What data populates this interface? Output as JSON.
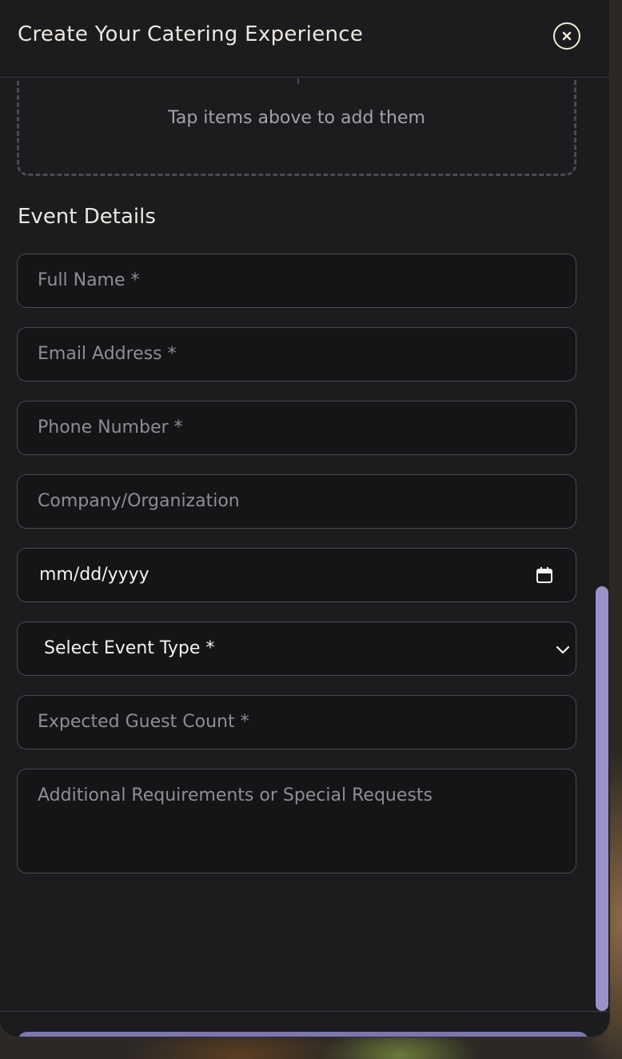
{
  "modal": {
    "title": "Create Your Catering Experience",
    "close_icon": "close-circle-icon"
  },
  "dropzone": {
    "hint": "Tap items above to add them"
  },
  "event_details": {
    "title": "Event Details",
    "fields": {
      "full_name": {
        "placeholder": "Full Name *"
      },
      "email": {
        "placeholder": "Email Address *"
      },
      "phone": {
        "placeholder": "Phone Number *"
      },
      "company": {
        "placeholder": "Company/Organization"
      },
      "date": {
        "value": "mm/dd/yyyy",
        "icon": "calendar-icon"
      },
      "event_type": {
        "value": "Select Event Type *",
        "icon": "chevron-down-icon"
      },
      "guest_count": {
        "placeholder": "Expected Guest Count *"
      },
      "requests": {
        "placeholder": "Additional Requirements or Special Requests"
      }
    }
  },
  "colors": {
    "modal_bg": "#1c1c1e",
    "field_bg": "#151517",
    "accent": "#9b92c9"
  }
}
